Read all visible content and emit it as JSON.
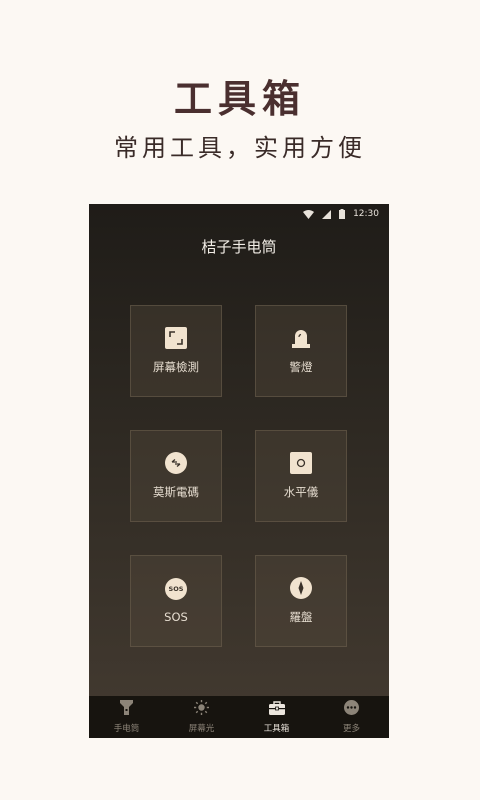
{
  "hero": {
    "title": "工具箱",
    "subtitle": "常用工具，实用方便"
  },
  "status_bar": {
    "time": "12:30",
    "icons": [
      "wifi-icon",
      "signal-icon",
      "battery-icon"
    ]
  },
  "app": {
    "title": "桔子手电筒"
  },
  "tools": [
    {
      "label": "屏幕檢測",
      "icon": "screen-frame-icon"
    },
    {
      "label": "警燈",
      "icon": "alarm-light-icon"
    },
    {
      "label": "莫斯電碼",
      "icon": "morse-code-icon"
    },
    {
      "label": "水平儀",
      "icon": "level-icon"
    },
    {
      "label": "SOS",
      "icon": "sos-icon",
      "icon_text": "SOS"
    },
    {
      "label": "羅盤",
      "icon": "compass-icon"
    }
  ],
  "bottom_nav": [
    {
      "label": "手电筒",
      "icon": "flashlight-icon",
      "active": false
    },
    {
      "label": "屏幕光",
      "icon": "sun-icon",
      "active": false
    },
    {
      "label": "工具箱",
      "icon": "toolbox-icon",
      "active": true
    },
    {
      "label": "更多",
      "icon": "more-icon",
      "active": false
    }
  ],
  "colors": {
    "page_background": "#fcf8f3",
    "title_color": "#4a2f2f",
    "icon_cream": "#f1e3cf",
    "nav_background": "#17140f"
  }
}
